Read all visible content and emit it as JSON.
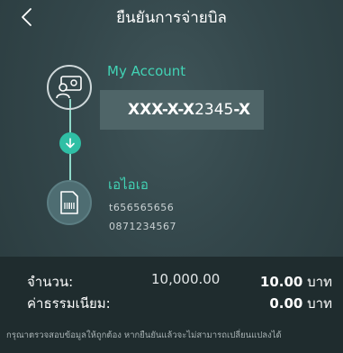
{
  "header": {
    "title": "ยืนยันการจ่ายบิล",
    "back_icon": "chevron-left-icon"
  },
  "from": {
    "icon": "account-card-icon",
    "label": "My Account",
    "account_prefix": "XXX-X-X",
    "account_mid": "2345",
    "account_suffix": "-X"
  },
  "flow": {
    "icon": "arrow-down-icon"
  },
  "to": {
    "icon": "bill-document-icon",
    "name": "เอไอเอ",
    "ref1": "t656565656",
    "ref2": "0871234567"
  },
  "summary": {
    "amount_label": "จำนวน:",
    "amount_value": "10,000.00",
    "amount_fee_value": "10.00",
    "fee_label": "ค่าธรรมเนียม:",
    "fee_value": "0.00",
    "currency": "บาท",
    "note": "กรุณาตรวจสอบข้อมูลให้ถูกต้อง หากยืนยันแล้วจะไม่สามารถเปลี่ยนแปลงได้"
  },
  "colors": {
    "accent": "#42d3b5",
    "arrow_dot": "#2fbfa5",
    "summary_bg": "#1f2c2e",
    "account_box": "#4f6568"
  }
}
